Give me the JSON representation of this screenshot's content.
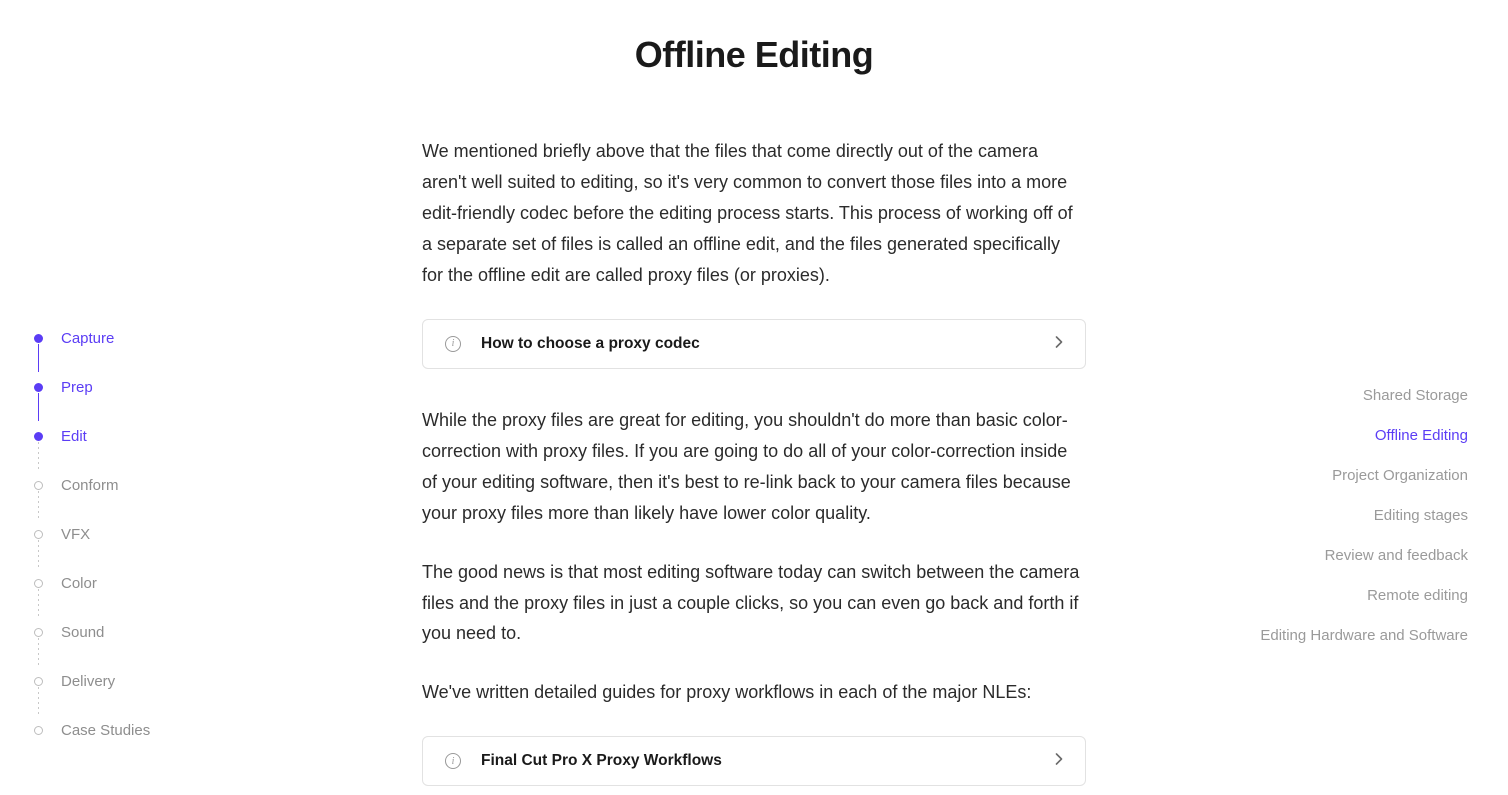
{
  "leftNav": {
    "items": [
      {
        "label": "Capture",
        "state": "visited",
        "connector": "solid"
      },
      {
        "label": "Prep",
        "state": "visited",
        "connector": "solid"
      },
      {
        "label": "Edit",
        "state": "active",
        "connector": "dotted"
      },
      {
        "label": "Conform",
        "state": "future",
        "connector": "dotted"
      },
      {
        "label": "VFX",
        "state": "future",
        "connector": "dotted"
      },
      {
        "label": "Color",
        "state": "future",
        "connector": "dotted"
      },
      {
        "label": "Sound",
        "state": "future",
        "connector": "dotted"
      },
      {
        "label": "Delivery",
        "state": "future",
        "connector": "dotted"
      },
      {
        "label": "Case Studies",
        "state": "future",
        "connector": null
      }
    ]
  },
  "main": {
    "title": "Offline Editing",
    "p1": "We mentioned briefly above that the files that come directly out of the camera aren't well suited to editing, so it's very common to convert those files into a more edit-friendly codec before the editing process starts. This process of working off of a separate set of files is called an offline edit, and the files generated specifically for the offline edit are called proxy files (or proxies).",
    "expand1": "How to choose a proxy codec",
    "p2": "While the proxy files are great for editing, you shouldn't do more than basic color-correction with proxy files. If you are going to do all of your color-correction inside of your editing software, then it's best to re-link back to your camera files because your proxy files more than likely have lower color quality.",
    "p3": "The good news is that most editing software today can switch between the camera files and the proxy files in just a couple clicks, so you can even go back and forth if you need to.",
    "p4": "We've written detailed guides for proxy workflows in each of the major NLEs:",
    "expand2": "Final Cut Pro X Proxy Workflows"
  },
  "rightNav": {
    "items": [
      {
        "label": "Shared Storage",
        "active": false
      },
      {
        "label": "Offline Editing",
        "active": true
      },
      {
        "label": "Project Organization",
        "active": false
      },
      {
        "label": "Editing stages",
        "active": false
      },
      {
        "label": "Review and feedback",
        "active": false
      },
      {
        "label": "Remote editing",
        "active": false
      },
      {
        "label": "Editing Hardware and Software",
        "active": false
      }
    ]
  }
}
